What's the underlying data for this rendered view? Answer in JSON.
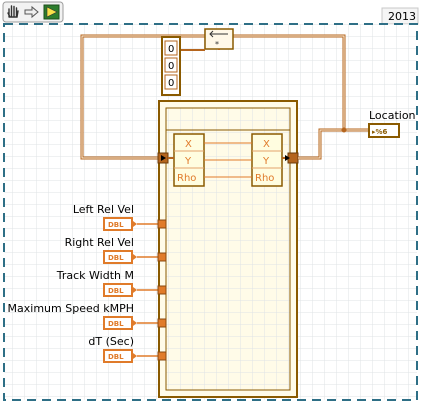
{
  "toolbar": {
    "icons": [
      "hand-tool-icon",
      "arrow-tool-icon",
      "run-arrow-icon"
    ],
    "version": "2013"
  },
  "colors": {
    "wire": "#b5651d",
    "wire_bundle": "#e3a36b",
    "cluster": "#8a5a00",
    "dbl": "#e07b2a",
    "frame": "#2e6f86",
    "grid": "#dfe3e6"
  },
  "diagram": {
    "location_label": "Location",
    "location_terminal": "▸%6",
    "feedback_values": [
      "0",
      "0",
      "0"
    ],
    "unbundle_elements": [
      "X",
      "Y",
      "Rho"
    ],
    "bundle_elements": [
      "X",
      "Y",
      "Rho"
    ],
    "controls": [
      {
        "label": "Left Rel Vel",
        "type": "DBL"
      },
      {
        "label": "Right Rel Vel",
        "type": "DBL"
      },
      {
        "label": "Track Width M",
        "type": "DBL"
      },
      {
        "label": "Maximum Speed kMPH",
        "type": "DBL"
      },
      {
        "label": "dT (Sec)",
        "type": "DBL"
      }
    ]
  }
}
